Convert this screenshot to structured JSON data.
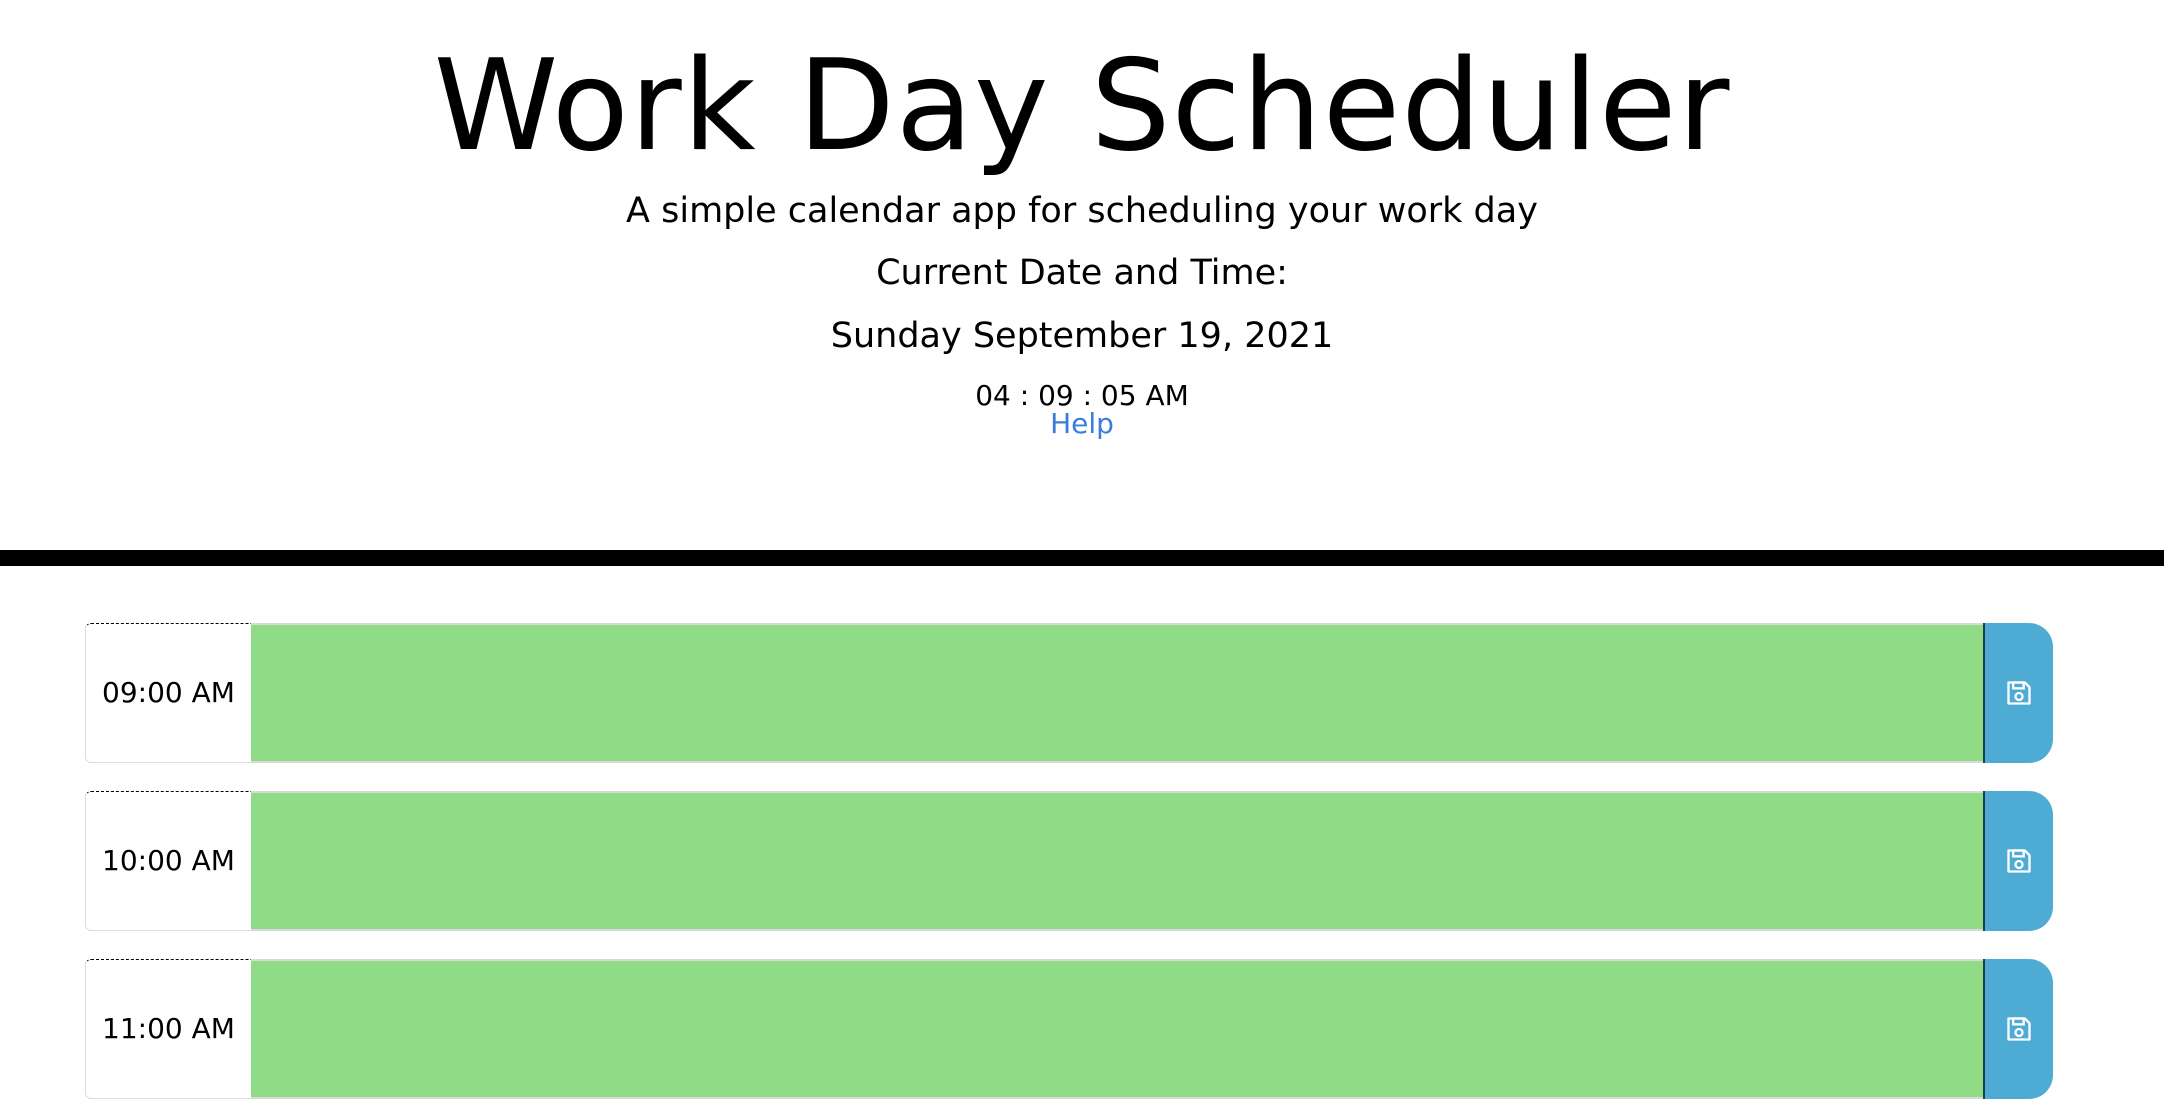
{
  "header": {
    "title": "Work Day Scheduler",
    "subtitle": "A simple calendar app for scheduling your work day",
    "date_label": "Current Date and Time:",
    "current_date": "Sunday September 19, 2021",
    "current_time": "04 : 09 : 05 AM",
    "help_label": "Help"
  },
  "schedule": {
    "blocks": [
      {
        "hour": "09:00 AM",
        "description": "",
        "status": "future",
        "save_icon": "floppy-disk-icon"
      },
      {
        "hour": "10:00 AM",
        "description": "",
        "status": "future",
        "save_icon": "floppy-disk-icon"
      },
      {
        "hour": "11:00 AM",
        "description": "",
        "status": "future",
        "save_icon": "floppy-disk-icon"
      }
    ]
  },
  "colors": {
    "future": "#90db85",
    "save_button": "#4eabd4",
    "link": "#3b7ddd",
    "divider": "#000000"
  }
}
